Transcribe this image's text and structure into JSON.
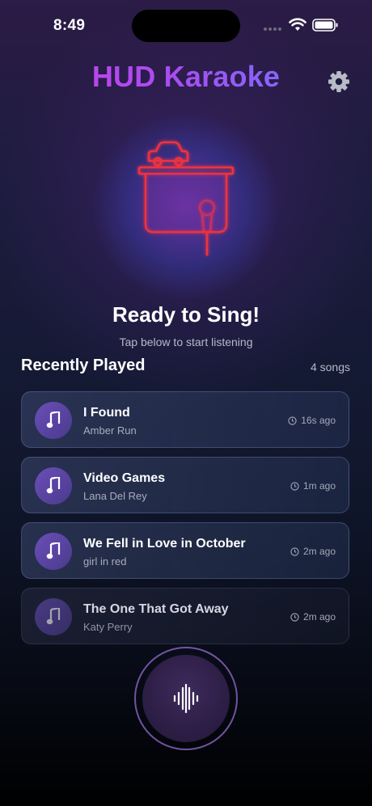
{
  "status_bar": {
    "time": "8:49"
  },
  "header": {
    "title": "HUD Karaoke",
    "settings_icon": "gear-icon"
  },
  "hero": {
    "icon": "karaoke-booth-icon",
    "title": "Ready to Sing!",
    "subtitle": "Tap below to start listening"
  },
  "recent": {
    "title": "Recently Played",
    "count": "4 songs",
    "songs": [
      {
        "title": "I Found",
        "artist": "Amber Run",
        "time": "16s ago"
      },
      {
        "title": "Video Games",
        "artist": "Lana Del Rey",
        "time": "1m ago"
      },
      {
        "title": "We Fell in Love in October",
        "artist": "girl in red",
        "time": "2m ago"
      },
      {
        "title": "The One That Got Away",
        "artist": "Katy Perry",
        "time": "2m ago"
      }
    ]
  },
  "listen_button": {
    "icon": "waveform-icon"
  },
  "colors": {
    "title_gradient_start": "#c943e8",
    "title_gradient_end": "#6a7bff",
    "neon_red": "#e8323c"
  }
}
